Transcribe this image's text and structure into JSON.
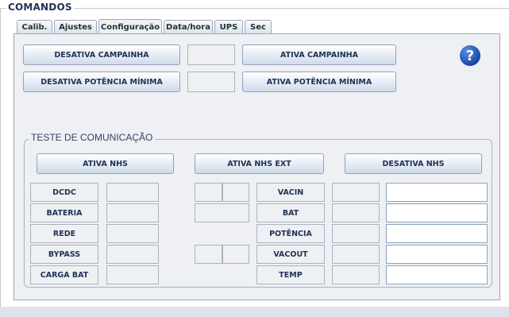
{
  "window": {
    "title": "COMANDOS"
  },
  "tabs": [
    {
      "label": "Calib."
    },
    {
      "label": "Ajustes"
    },
    {
      "label": "Configuração",
      "active": true
    },
    {
      "label": "Data/hora"
    },
    {
      "label": "UPS"
    },
    {
      "label": "Sec"
    }
  ],
  "controls": {
    "desativa_campainha": "DESATIVA CAMPAINHA",
    "ativa_campainha": "ATIVA CAMPAINHA",
    "desativa_potencia_minima": "DESATIVA POTÊNCIA MÍNIMA",
    "ativa_potencia_minima": "ATIVA POTÊNCIA MÍNIMA",
    "help_icon": "question-mark-icon",
    "help_symbol": "?"
  },
  "comm_test": {
    "title": "TESTE DE COMUNICAÇÃO",
    "ativa_nhs": "ATIVA NHS",
    "ativa_nhs_ext": "ATIVA NHS EXT",
    "desativa_nhs": "DESATIVA NHS",
    "left_labels": [
      "DCDC",
      "BATERIA",
      "REDE",
      "BYPASS",
      "CARGA BAT"
    ],
    "right_labels": [
      "VACIN",
      "BAT",
      "POTÊNCIA",
      "VACOUT",
      "TEMP"
    ],
    "right_values": [
      "",
      "",
      "",
      "",
      ""
    ]
  },
  "colors": {
    "accent": "#1747a6",
    "panel": "#eef0f3"
  }
}
